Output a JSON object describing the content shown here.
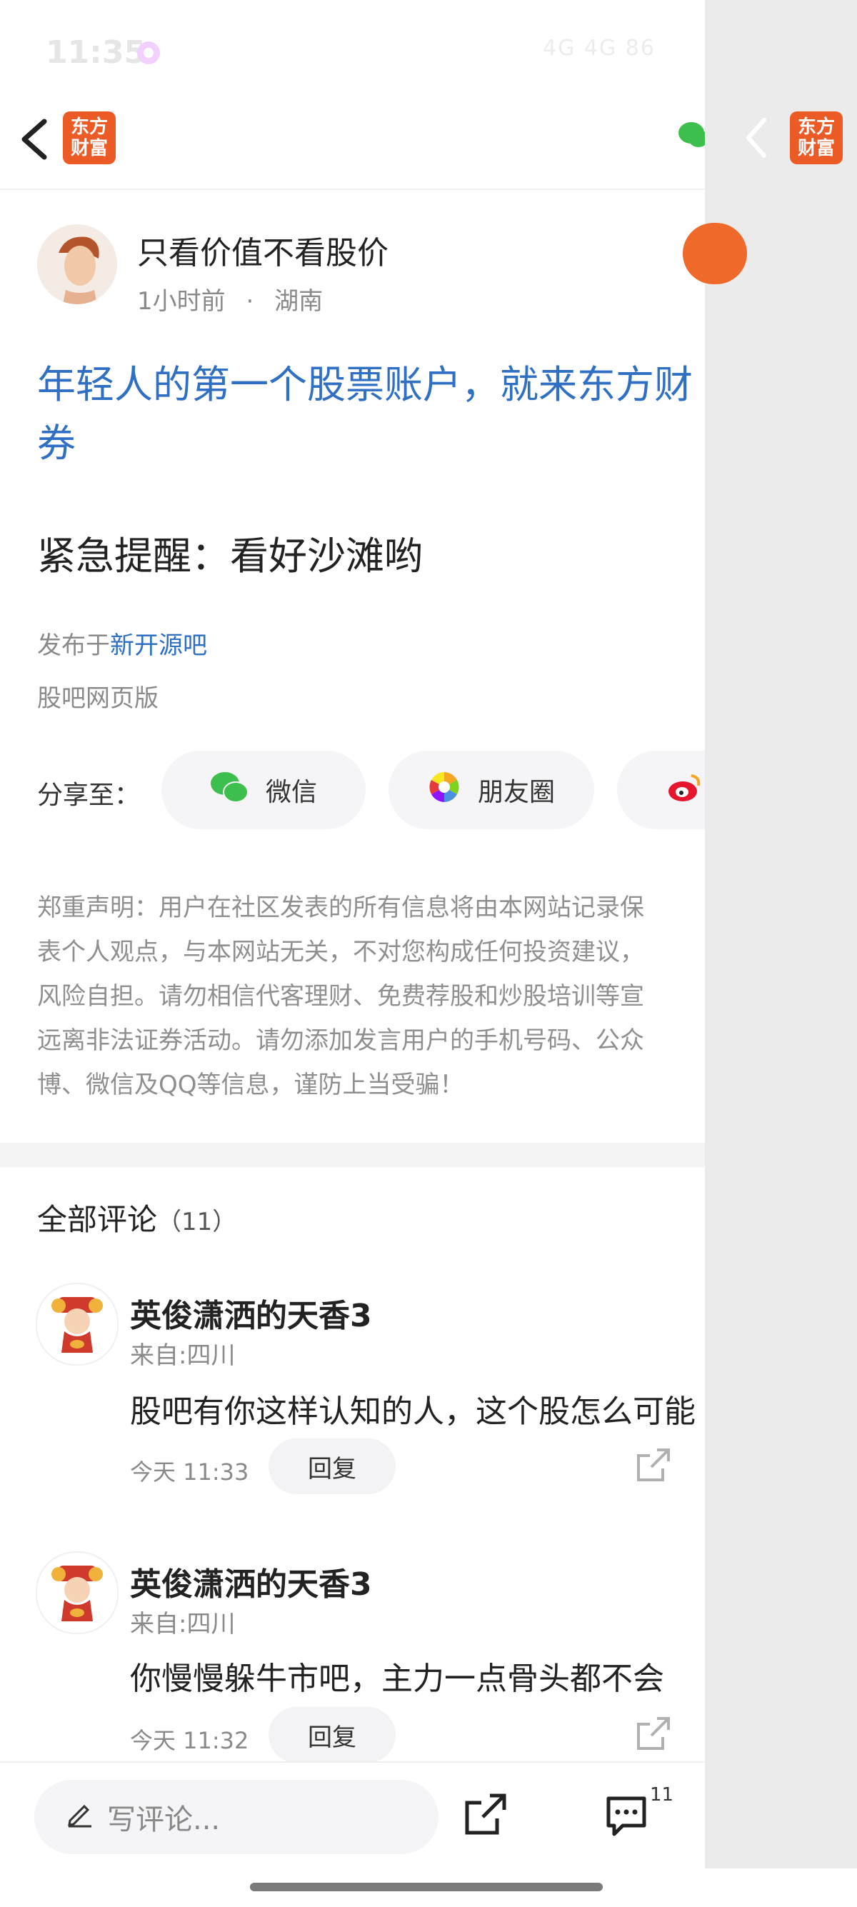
{
  "status_bar": {
    "time": "11:35",
    "right": "4G  4G  86"
  },
  "header": {
    "logo_text_line1": "东方",
    "logo_text_line2": "财富"
  },
  "post": {
    "author_name": "只看价值不看股价",
    "time": "1小时前",
    "location": "湖南",
    "title_line1": "年轻人的第一个股票账户，就来东方财",
    "title_line2": "券",
    "content": "紧急提醒：看好沙滩哟",
    "published_prefix": "发布于",
    "published_bar": "新开源吧",
    "source": "股吧网页版"
  },
  "share": {
    "label": "分享至：",
    "wechat": "微信",
    "moments": "朋友圈"
  },
  "disclaimer": {
    "lines": [
      "郑重声明：用户在社区发表的所有信息将由本网站记录保",
      "表个人观点，与本网站无关，不对您构成任何投资建议，",
      "风险自担。请勿相信代客理财、免费荐股和炒股培训等宣",
      "远离非法证券活动。请勿添加发言用户的手机号码、公众",
      "博、微信及QQ等信息，谨防上当受骗！"
    ]
  },
  "comments": {
    "title": "全部评论",
    "count": "（11）",
    "items": [
      {
        "name": "英俊潇洒的天香3",
        "from": "来自:四川",
        "text": "股吧有你这样认知的人，这个股怎么可能",
        "time": "今天 11:33",
        "reply": "回复"
      },
      {
        "name": "英俊潇洒的天香3",
        "from": "来自:四川",
        "text": "你慢慢躲牛市吧，主力一点骨头都不会",
        "time": "今天 11:32",
        "reply": "回复"
      }
    ]
  },
  "bottom_bar": {
    "placeholder": "写评论...",
    "comment_count": "11"
  },
  "colors": {
    "brand": "#ec5a26",
    "link": "#2f6fc4",
    "wechat": "#3cbf4c"
  }
}
